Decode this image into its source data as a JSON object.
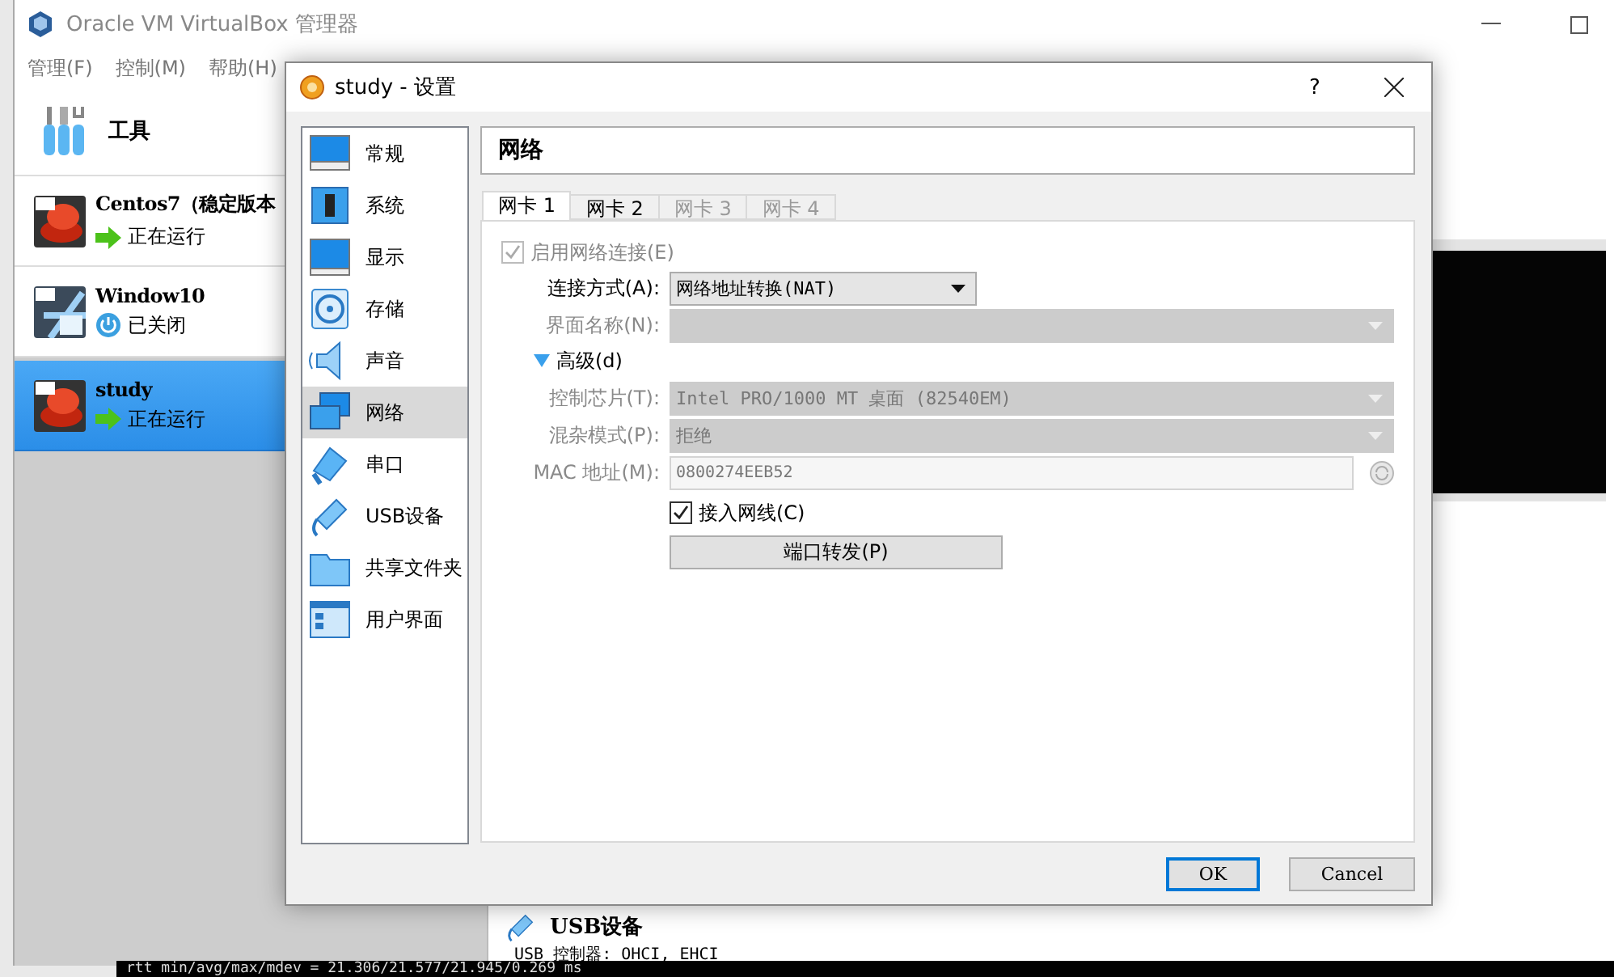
{
  "manager": {
    "title": "Oracle VM VirtualBox 管理器",
    "menu": [
      "管理(F)",
      "控制(M)",
      "帮助(H)"
    ],
    "tools": {
      "label": "工具"
    },
    "vms": [
      {
        "name": "Centos7（稳定版本",
        "status": "正在运行",
        "selected": false
      },
      {
        "name": "Window10",
        "status": "已关闭",
        "selected": false
      },
      {
        "name": "study",
        "status": "正在运行",
        "selected": true
      }
    ],
    "details": {
      "section": "USB设备",
      "line": "USB 控制器:  OHCI, EHCI"
    },
    "terminal": "rtt min/avg/max/mdev = 21.306/21.577/21.945/0.269 ms"
  },
  "dialog": {
    "title": "study - 设置",
    "help": "?",
    "categories": [
      {
        "label": "常规",
        "selected": false
      },
      {
        "label": "系统",
        "selected": false
      },
      {
        "label": "显示",
        "selected": false
      },
      {
        "label": "存储",
        "selected": false
      },
      {
        "label": "声音",
        "selected": false
      },
      {
        "label": "网络",
        "selected": true
      },
      {
        "label": "串口",
        "selected": false
      },
      {
        "label": "USB设备",
        "selected": false
      },
      {
        "label": "共享文件夹",
        "selected": false
      },
      {
        "label": "用户界面",
        "selected": false
      }
    ],
    "page_title": "网络",
    "tabs": [
      {
        "label": "网卡 1",
        "selected": true,
        "disabled": false
      },
      {
        "label": "网卡 2",
        "selected": false,
        "disabled": false
      },
      {
        "label": "网卡 3",
        "selected": false,
        "disabled": true
      },
      {
        "label": "网卡 4",
        "selected": false,
        "disabled": true
      }
    ],
    "enable": {
      "label": "启用网络连接(E)",
      "checked": true,
      "disabled": true
    },
    "fields": [
      {
        "kind": "combo",
        "label": "连接方式(A):",
        "value": "网络地址转换(NAT)",
        "disabled": false
      },
      {
        "kind": "combo",
        "label": "界面名称(N):",
        "disabled": true
      }
    ],
    "advanced": {
      "label": "高级(d)",
      "expanded": true
    },
    "advanced_fields": [
      {
        "kind": "combo",
        "label": "控制芯片(T):",
        "value": "Intel PRO/1000 MT 桌面 (82540EM)",
        "disabled": true
      },
      {
        "kind": "combo",
        "label": "混杂模式(P):",
        "value": "拒绝",
        "disabled": true
      },
      {
        "kind": "text",
        "label": "MAC 地址(M):",
        "value": "0800274EEB52",
        "disabled": true
      }
    ],
    "cable": {
      "label": "接入网线(C)",
      "checked": true,
      "disabled": false
    },
    "port_forward": "端口转发(P)",
    "buttons": [
      {
        "label": "OK",
        "default": true
      },
      {
        "label": "Cancel",
        "default": false
      }
    ]
  }
}
